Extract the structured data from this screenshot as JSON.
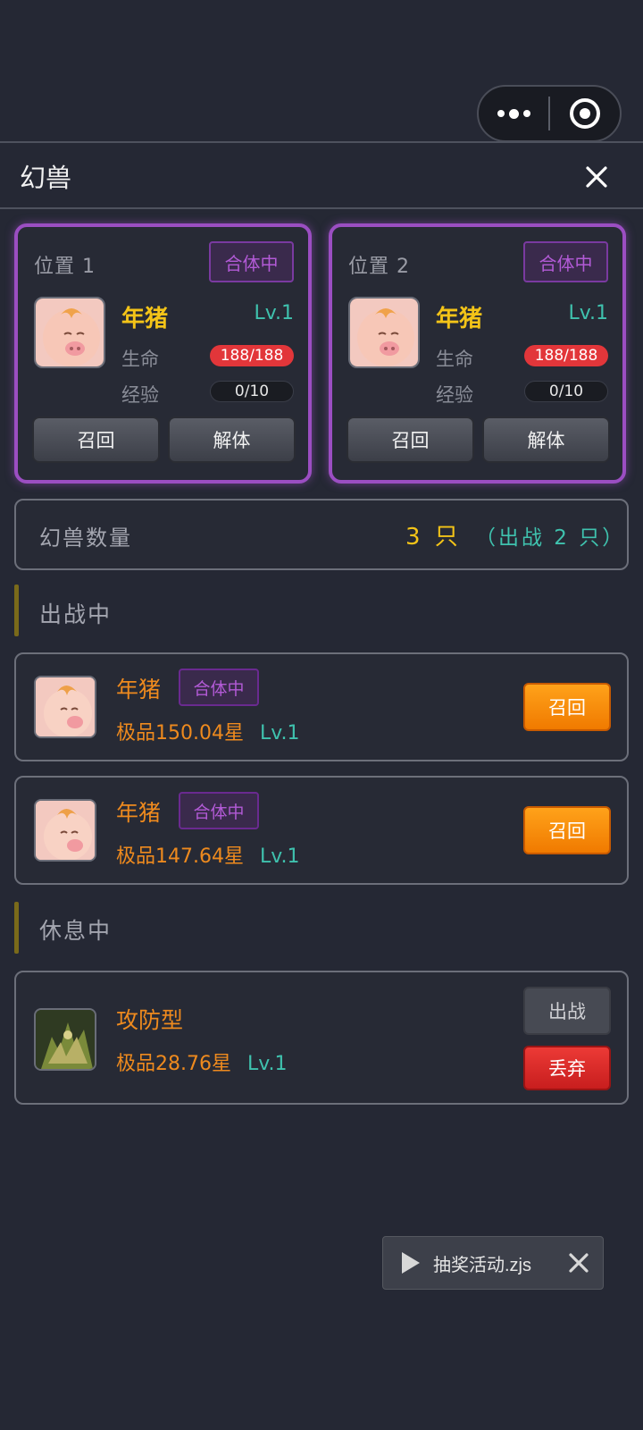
{
  "capsule": {
    "more_icon": "more-dots-icon",
    "target_icon": "target-icon"
  },
  "header": {
    "title": "幻兽",
    "close_icon": "close-icon"
  },
  "slots": [
    {
      "label": "位置 1",
      "tag": "合体中",
      "name": "年猪",
      "level": "Lv.1",
      "hp_label": "生命",
      "hp": "188/188",
      "exp_label": "经验",
      "exp": "0/10",
      "btn_recall": "召回",
      "btn_split": "解体"
    },
    {
      "label": "位置 2",
      "tag": "合体中",
      "name": "年猪",
      "level": "Lv.1",
      "hp_label": "生命",
      "hp": "188/188",
      "exp_label": "经验",
      "exp": "0/10",
      "btn_recall": "召回",
      "btn_split": "解体"
    }
  ],
  "summary": {
    "label": "幻兽数量",
    "count": "3 只",
    "battle": "（出战 2 只）"
  },
  "battle_section": {
    "title": "出战中"
  },
  "battle_pets": [
    {
      "name": "年猪",
      "tag": "合体中",
      "quality": "极品150.04星",
      "level": "Lv.1",
      "action": "召回"
    },
    {
      "name": "年猪",
      "tag": "合体中",
      "quality": "极品147.64星",
      "level": "Lv.1",
      "action": "召回"
    }
  ],
  "rest_section": {
    "title": "休息中"
  },
  "rest_pets": [
    {
      "name": "攻防型",
      "quality": "极品28.76星",
      "level": "Lv.1",
      "action_deploy": "出战",
      "action_discard": "丢弃"
    }
  ],
  "toast": {
    "text": "抽奖活动.zjs"
  },
  "colors": {
    "accent_purple": "#9b4ec2",
    "gold": "#f4c418",
    "teal": "#3fc2ae",
    "orange": "#ee8a1e",
    "hp_red": "#e2363a"
  }
}
